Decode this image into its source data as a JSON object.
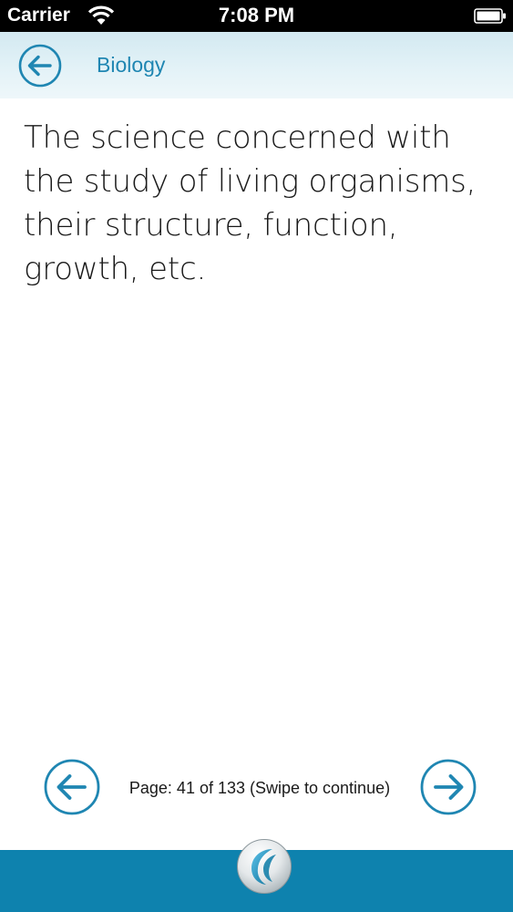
{
  "status_bar": {
    "carrier": "Carrier",
    "time": "7:08 PM",
    "icons": [
      "wifi-icon",
      "battery-icon"
    ]
  },
  "header": {
    "title": "Biology",
    "back_icon": "arrow-left-circle-icon"
  },
  "content": {
    "definition": "The science concerned with the study of living organisms, their structure, function, growth, etc."
  },
  "pager": {
    "page_text": "Page: 41 of 133 (Swipe to continue)",
    "current_page": 41,
    "total_pages": 133,
    "prev_icon": "arrow-left-circle-icon",
    "next_icon": "arrow-right-circle-icon"
  },
  "bottom_bar": {
    "logo_icon": "app-logo-icon"
  },
  "colors": {
    "accent": "#1f86b2",
    "bottom_bar": "#0e82ae",
    "header_bg": "#dff0f6",
    "text": "#1a1a1a",
    "status_bar": "#000000"
  }
}
